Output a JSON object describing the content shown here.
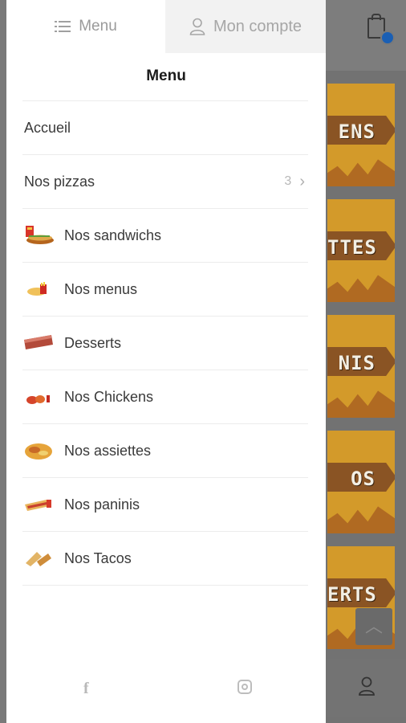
{
  "tabs": {
    "menu_label": "Menu",
    "account_label": "Mon compte"
  },
  "drawer": {
    "title": "Menu",
    "items": [
      {
        "label": "Accueil",
        "icon": null
      },
      {
        "label": "Nos pizzas",
        "count": "3",
        "icon": "chevron-right-icon"
      },
      {
        "label": "Nos sandwichs",
        "icon": "sandwich-thumb"
      },
      {
        "label": "Nos menus",
        "icon": "menu-thumb"
      },
      {
        "label": "Desserts",
        "icon": "dessert-thumb"
      },
      {
        "label": "Nos Chickens",
        "icon": "chicken-thumb"
      },
      {
        "label": "Nos assiettes",
        "icon": "plate-thumb"
      },
      {
        "label": "Nos paninis",
        "icon": "panini-thumb"
      },
      {
        "label": "Nos Tacos",
        "icon": "tacos-thumb"
      }
    ],
    "social": {
      "facebook": "f"
    }
  },
  "background": {
    "cards": [
      "ENS",
      "TTES",
      "NIS",
      "OS",
      "ERTS"
    ]
  },
  "colors": {
    "accent_badge": "#1a5fb4",
    "card": "#d39a2a",
    "banner": "#8a5424"
  }
}
